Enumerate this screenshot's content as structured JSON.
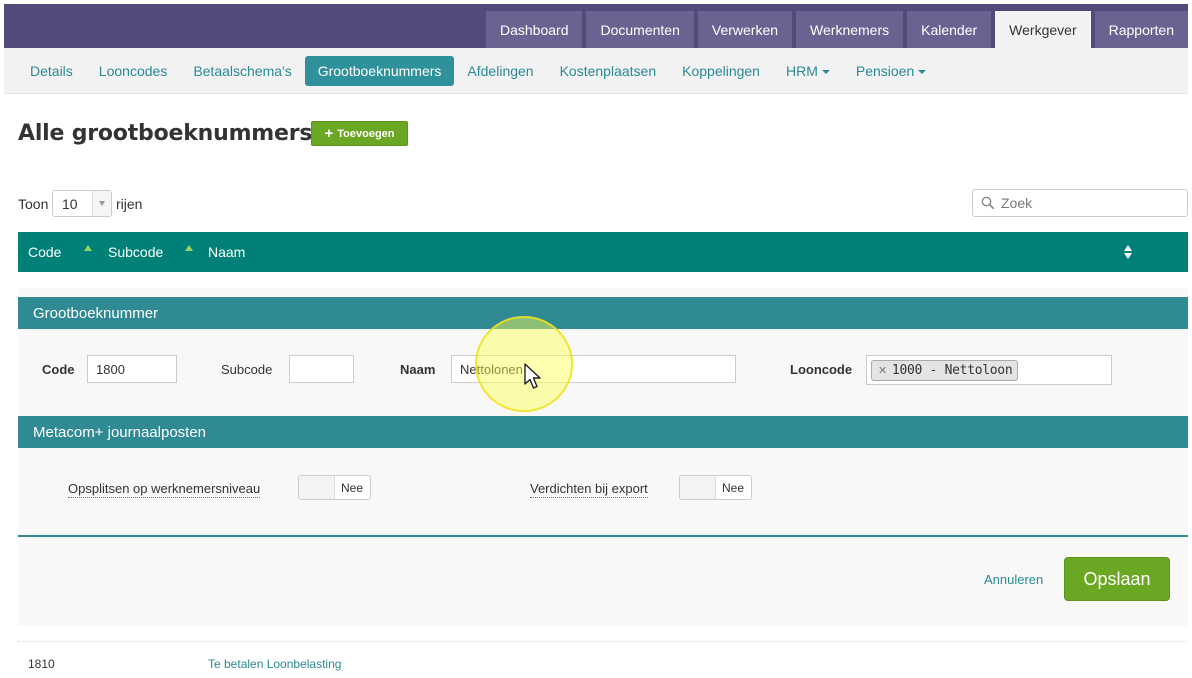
{
  "topnav": {
    "tabs": [
      {
        "label": "Dashboard",
        "active": false
      },
      {
        "label": "Documenten",
        "active": false
      },
      {
        "label": "Verwerken",
        "active": false
      },
      {
        "label": "Werknemers",
        "active": false
      },
      {
        "label": "Kalender",
        "active": false
      },
      {
        "label": "Werkgever",
        "active": true
      },
      {
        "label": "Rapporten",
        "active": false
      }
    ]
  },
  "subnav": {
    "items": [
      {
        "label": "Details"
      },
      {
        "label": "Looncodes"
      },
      {
        "label": "Betaalschema's"
      },
      {
        "label": "Grootboeknummers",
        "active": true
      },
      {
        "label": "Afdelingen"
      },
      {
        "label": "Kostenplaatsen"
      },
      {
        "label": "Koppelingen"
      },
      {
        "label": "HRM",
        "dropdown": true
      },
      {
        "label": "Pensioen",
        "dropdown": true
      }
    ]
  },
  "page": {
    "title": "Alle grootboeknummers",
    "add_button": "Toevoegen"
  },
  "table_controls": {
    "show_label": "Toon",
    "page_length": "10",
    "rows_label": "rijen",
    "search_placeholder": "Zoek"
  },
  "table": {
    "columns": [
      "Code",
      "Subcode",
      "Naam"
    ],
    "rows": [
      {
        "code": "1810",
        "subcode": "",
        "naam": "Te betalen Loonbelasting"
      }
    ]
  },
  "form": {
    "section_title": "Grootboeknummer",
    "code_label": "Code",
    "code_value": "1800",
    "subcode_label": "Subcode",
    "subcode_value": "",
    "naam_label": "Naam",
    "naam_value": "Nettolonen",
    "looncode_label": "Looncode",
    "looncode_tag": "1000 - Nettoloon",
    "journal_section_title": "Metacom+ journaalposten",
    "split_label": "Opsplitsen op werknemersniveau",
    "split_value": "Nee",
    "compress_label": "Verdichten bij export",
    "compress_value": "Nee",
    "cancel_label": "Annuleren",
    "save_label": "Opslaan"
  },
  "colors": {
    "top_nav": "#54497b",
    "accent_teal": "#2f8a94",
    "table_header": "#018077",
    "green": "#6aa723"
  }
}
